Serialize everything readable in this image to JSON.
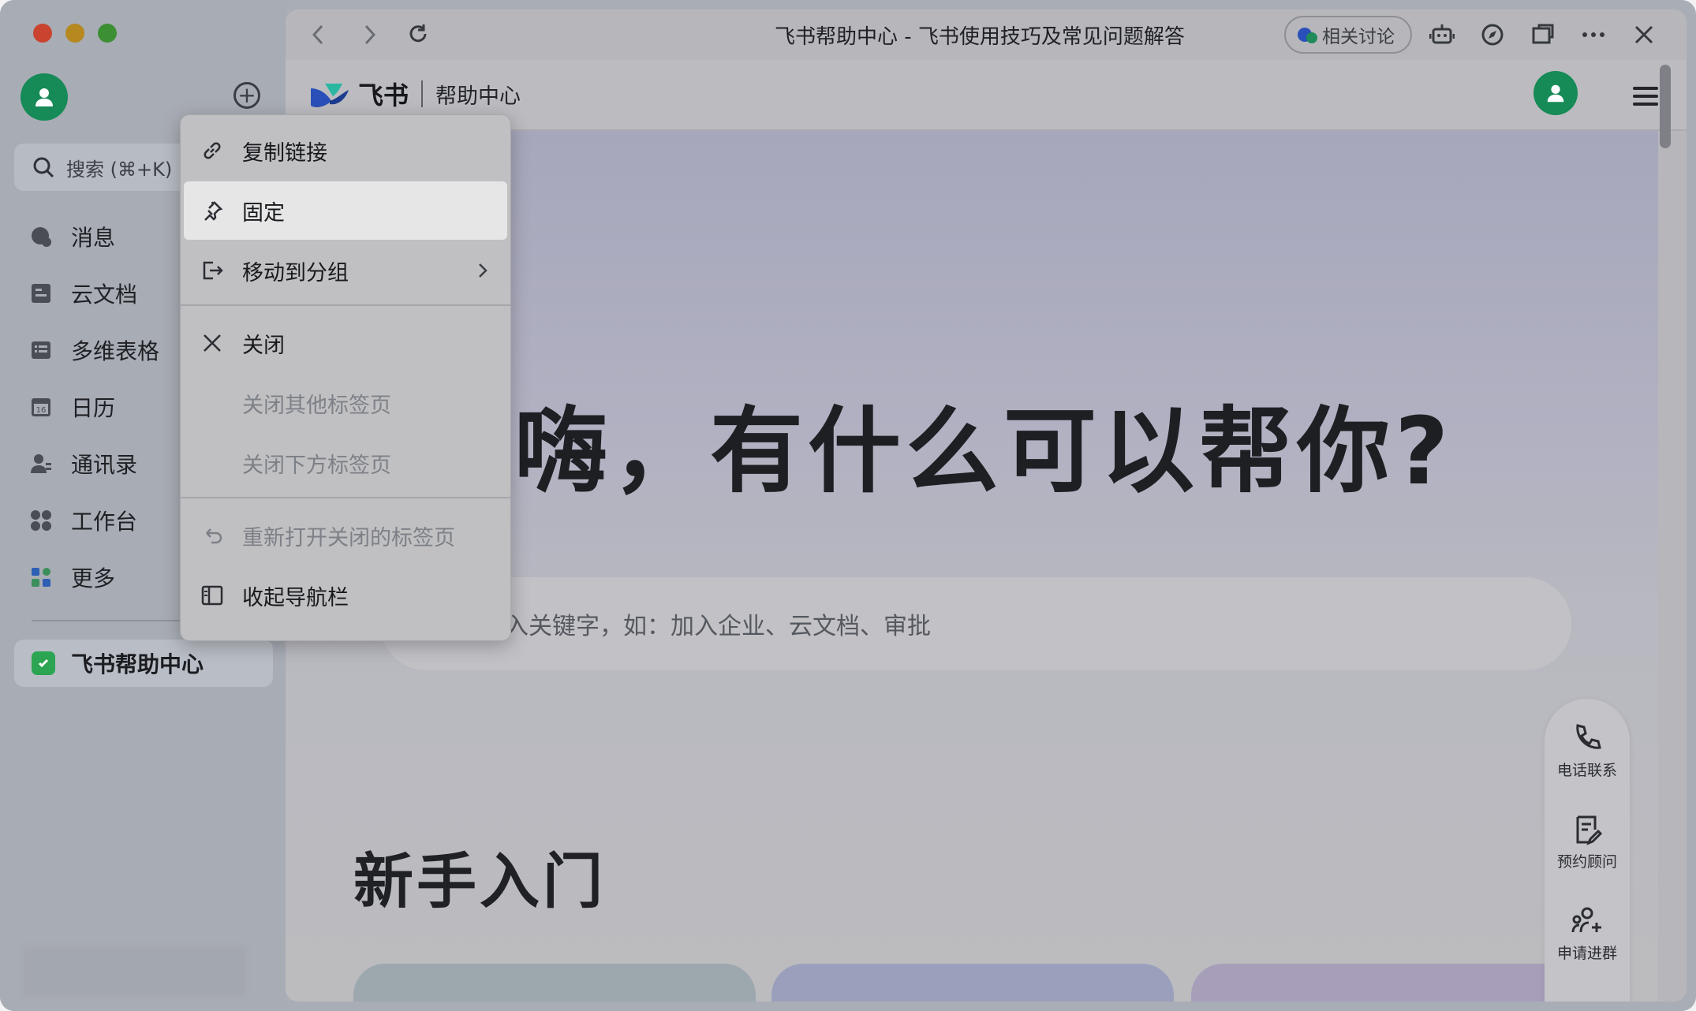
{
  "window": {
    "title": "飞书帮助中心 - 飞书使用技巧及常见问题解答"
  },
  "sidebar": {
    "search_placeholder": "搜索 (⌘+K)",
    "items": [
      {
        "label": "消息",
        "icon": "chat-icon"
      },
      {
        "label": "云文档",
        "icon": "docs-icon"
      },
      {
        "label": "多维表格",
        "icon": "table-icon"
      },
      {
        "label": "日历",
        "icon": "calendar-icon",
        "badge": "16"
      },
      {
        "label": "通讯录",
        "icon": "contacts-icon"
      },
      {
        "label": "工作台",
        "icon": "apps-grid-icon"
      },
      {
        "label": "更多",
        "icon": "more-icon"
      }
    ],
    "open_tab": "飞书帮助中心"
  },
  "toolbar": {
    "discuss_label": "相关讨论"
  },
  "header": {
    "brand": "飞书",
    "subtitle": "帮助中心"
  },
  "hero": {
    "title": "嗨，有什么可以帮你?",
    "search_placeholder": "输入关键字，如：加入企业、云文档、审批",
    "section_title": "新手入门"
  },
  "side_panel": {
    "items": [
      {
        "label": "电话联系",
        "icon": "phone-icon"
      },
      {
        "label": "预约顾问",
        "icon": "edit-note-icon"
      },
      {
        "label": "申请进群",
        "icon": "add-group-icon"
      }
    ]
  },
  "context_menu": {
    "items": [
      {
        "label": "复制链接",
        "icon": "link-icon",
        "enabled": true
      },
      {
        "label": "固定",
        "icon": "pin-icon",
        "enabled": true,
        "selected": true
      },
      {
        "label": "移动到分组",
        "icon": "move-icon",
        "enabled": true,
        "submenu": true
      },
      {
        "label": "关闭",
        "icon": "close-icon",
        "enabled": true
      },
      {
        "label": "关闭其他标签页",
        "enabled": false
      },
      {
        "label": "关闭下方标签页",
        "enabled": false
      },
      {
        "label": "重新打开关闭的标签页",
        "icon": "undo-icon",
        "enabled": false
      },
      {
        "label": "收起导航栏",
        "icon": "sidebar-collapse-icon",
        "enabled": true
      }
    ]
  },
  "colors": {
    "accent_green": "#168a57",
    "brand_blue": "#2a4fb8",
    "brand_teal": "#2bb6a2"
  }
}
